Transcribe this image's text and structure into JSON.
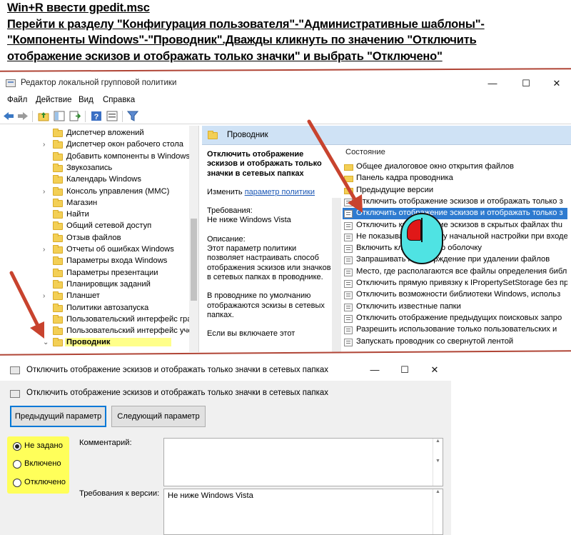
{
  "instructions": {
    "line1": "Win+R ввести gpedit.msc",
    "line2": "Перейти к разделу \"Конфигурация пользователя\"-\"Административные шаблоны\"-",
    "line3": "\"Компоненты Windows\"-\"Проводник\".Дважды кликнуть по значению \"Отключить",
    "line4": "отображение эскизов и отображать только значки\" и выбрать \"Отключено\""
  },
  "gpedit": {
    "title": "Редактор локальной групповой политики",
    "window_buttons": [
      "—",
      "☐",
      "✕"
    ],
    "menu": [
      "Файл",
      "Действие",
      "Вид",
      "Справка"
    ],
    "tree": [
      {
        "label": "Диспетчер вложений",
        "chevron": ""
      },
      {
        "label": "Диспетчер окон рабочего стола",
        "chevron": "›"
      },
      {
        "label": "Добавить компоненты в Windows",
        "chevron": ""
      },
      {
        "label": "Звукозапись",
        "chevron": ""
      },
      {
        "label": "Календарь Windows",
        "chevron": ""
      },
      {
        "label": "Консоль управления (MMC)",
        "chevron": "›"
      },
      {
        "label": "Магазин",
        "chevron": ""
      },
      {
        "label": "Найти",
        "chevron": ""
      },
      {
        "label": "Общий сетевой доступ",
        "chevron": ""
      },
      {
        "label": "Отзыв файлов",
        "chevron": ""
      },
      {
        "label": "Отчеты об ошибках Windows",
        "chevron": "›"
      },
      {
        "label": "Параметры входа Windows",
        "chevron": ""
      },
      {
        "label": "Параметры презентации",
        "chevron": ""
      },
      {
        "label": "Планировщик заданий",
        "chevron": ""
      },
      {
        "label": "Планшет",
        "chevron": "›"
      },
      {
        "label": "Политики автозапуска",
        "chevron": ""
      },
      {
        "label": "Пользовательский интерфейс гра",
        "chevron": ""
      },
      {
        "label": "Пользовательский интерфейс уче",
        "chevron": ""
      },
      {
        "label": "Проводник",
        "chevron": "⌄",
        "selected": true
      }
    ],
    "details_header": "Проводник",
    "description": {
      "policy_name": "Отключить отображение эскизов и отображать только значки в сетевых папках",
      "edit_prefix": "Изменить",
      "edit_link": "параметр политики",
      "requirements_label": "Требования:",
      "requirements_value": "Не ниже Windows Vista",
      "description_label": "Описание:",
      "description_text": "Этот параметр политики позволяет настраивать способ отображения эскизов или значков в сетевых папках в проводнике.",
      "default_text": "В проводнике по умолчанию отображаются эскизы в сетевых папках.",
      "cut_text": "Если вы включаете этот"
    },
    "list_header": "Состояние",
    "settings": [
      {
        "label": "Общее диалоговое окно открытия файлов",
        "icon": "folder"
      },
      {
        "label": "Панель кадра проводника",
        "icon": "folder"
      },
      {
        "label": "Предыдущие версии",
        "icon": "folder"
      },
      {
        "label": "Отключить отображение эскизов и отображать только з",
        "icon": "policy"
      },
      {
        "label": "Отключить отображение эскизов и отображать только з",
        "icon": "policy",
        "selected": true
      },
      {
        "label": "Отключить кэширование эскизов в скрытых файлах thu",
        "icon": "policy"
      },
      {
        "label": "Не показывать страницу начальной настройки при входе п",
        "icon": "policy"
      },
      {
        "label": "Включить классическую оболочку",
        "icon": "policy"
      },
      {
        "label": "Запрашивать подтверждение при удалении файлов",
        "icon": "policy"
      },
      {
        "label": "Место, где располагаются все файлы определения библ",
        "icon": "policy"
      },
      {
        "label": "Отключить прямую привязку к IPropertySetStorage без пр",
        "icon": "policy"
      },
      {
        "label": "Отключить возможности библиотеки Windows, использ",
        "icon": "policy"
      },
      {
        "label": "Отключить известные папки",
        "icon": "policy"
      },
      {
        "label": "Отключить отображение предыдущих поисковых запро",
        "icon": "policy"
      },
      {
        "label": "Разрешить использование только пользовательских и",
        "icon": "policy"
      },
      {
        "label": "Запускать проводник со свернутой лентой",
        "icon": "policy"
      }
    ]
  },
  "dialog": {
    "title": "Отключить отображение эскизов и отображать только значки в сетевых папках",
    "subtitle": "Отключить отображение эскизов и отображать только значки в сетевых папках",
    "window_buttons": [
      "—",
      "☐",
      "✕"
    ],
    "prev_button": "Предыдущий параметр",
    "next_button": "Следующий параметр",
    "options": [
      {
        "label": "Не задано",
        "checked": true
      },
      {
        "label": "Включено",
        "checked": false
      },
      {
        "label": "Отключено",
        "checked": false
      }
    ],
    "comment_label": "Комментарий:",
    "requirements_label": "Требования к версии:",
    "requirements_value": "Не ниже Windows Vista"
  },
  "colors": {
    "annotation": "#c8432e",
    "highlight": "#ffff5a",
    "selection": "#2e7bd0"
  },
  "icons": [
    "back-arrow-icon",
    "forward-arrow-icon",
    "folder-up-icon",
    "show-hide-tree-icon",
    "export-icon",
    "help-icon",
    "console-icon",
    "filter-icon",
    "mouse-click-icon"
  ]
}
